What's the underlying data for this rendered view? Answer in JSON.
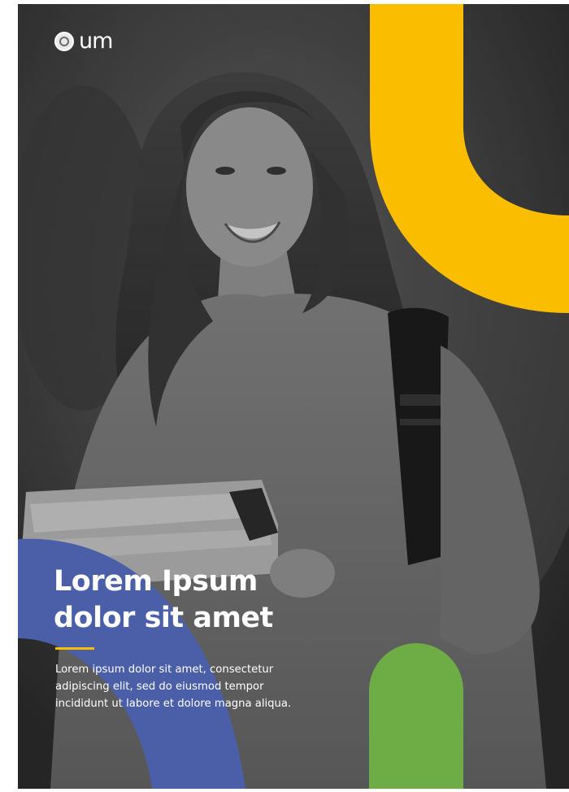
{
  "logo": {
    "wordmark": "um",
    "icon": "university-seal-icon"
  },
  "hero": {
    "title_lines": [
      "Lorem Ipsum",
      "dolor sit amet"
    ],
    "body_lines": [
      "Lorem ipsum dolor sit amet, consectetur",
      "adipiscing elit, sed do eiusmod tempor",
      "incididunt ut labore et dolore magna aliqua."
    ]
  },
  "colors": {
    "yellow_accent": "#fbbd00",
    "blue_accent": "#4a5fa8",
    "green_accent": "#6eac46",
    "photo_overlay": "#3a3a3a",
    "text": "#ffffff"
  },
  "photo": {
    "subject": "student-holding-books-photo",
    "treatment": "grayscale"
  }
}
